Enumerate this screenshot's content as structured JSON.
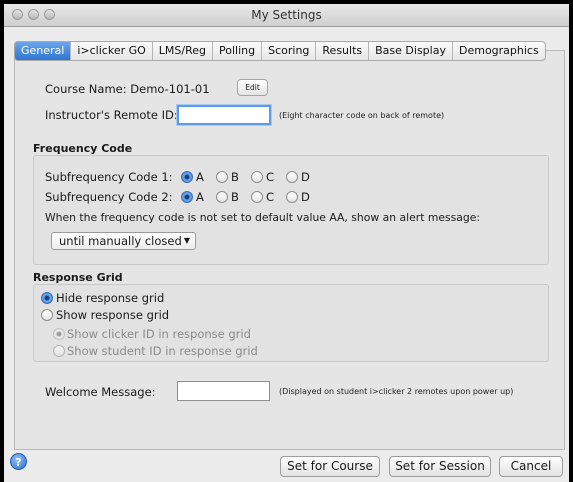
{
  "window": {
    "title": "My Settings"
  },
  "tabs": [
    "General",
    "i>clicker GO",
    "LMS/Reg",
    "Polling",
    "Scoring",
    "Results",
    "Base Display",
    "Demographics"
  ],
  "general": {
    "course_name_label": "Course Name: Demo-101-01",
    "edit_button": "Edit",
    "remote_id_label": "Instructor's Remote ID:",
    "remote_id_value": "",
    "remote_id_hint": "(Eight character code on back of remote)"
  },
  "frequency": {
    "title": "Frequency Code",
    "sub1_label": "Subfrequency Code 1:",
    "sub2_label": "Subfrequency Code 2:",
    "options": [
      "A",
      "B",
      "C",
      "D"
    ],
    "sub1_selected": "A",
    "sub2_selected": "A",
    "alert_text": "When the frequency code is not set to default value AA, show an alert message:",
    "alert_select_value": "until manually closed"
  },
  "response_grid": {
    "title": "Response Grid",
    "hide_label": "Hide response grid",
    "show_label": "Show response grid",
    "show_clicker_label": "Show clicker ID in response grid",
    "show_student_label": "Show student ID in response grid"
  },
  "welcome": {
    "label": "Welcome Message:",
    "value": "",
    "hint": "(Displayed on student i>clicker 2 remotes upon power up)"
  },
  "footer": {
    "help": "?",
    "set_course": "Set for Course",
    "set_session": "Set for Session",
    "cancel": "Cancel"
  },
  "colors": {
    "accent": "#3a7fd6",
    "tab_active": "#2f75d2"
  }
}
